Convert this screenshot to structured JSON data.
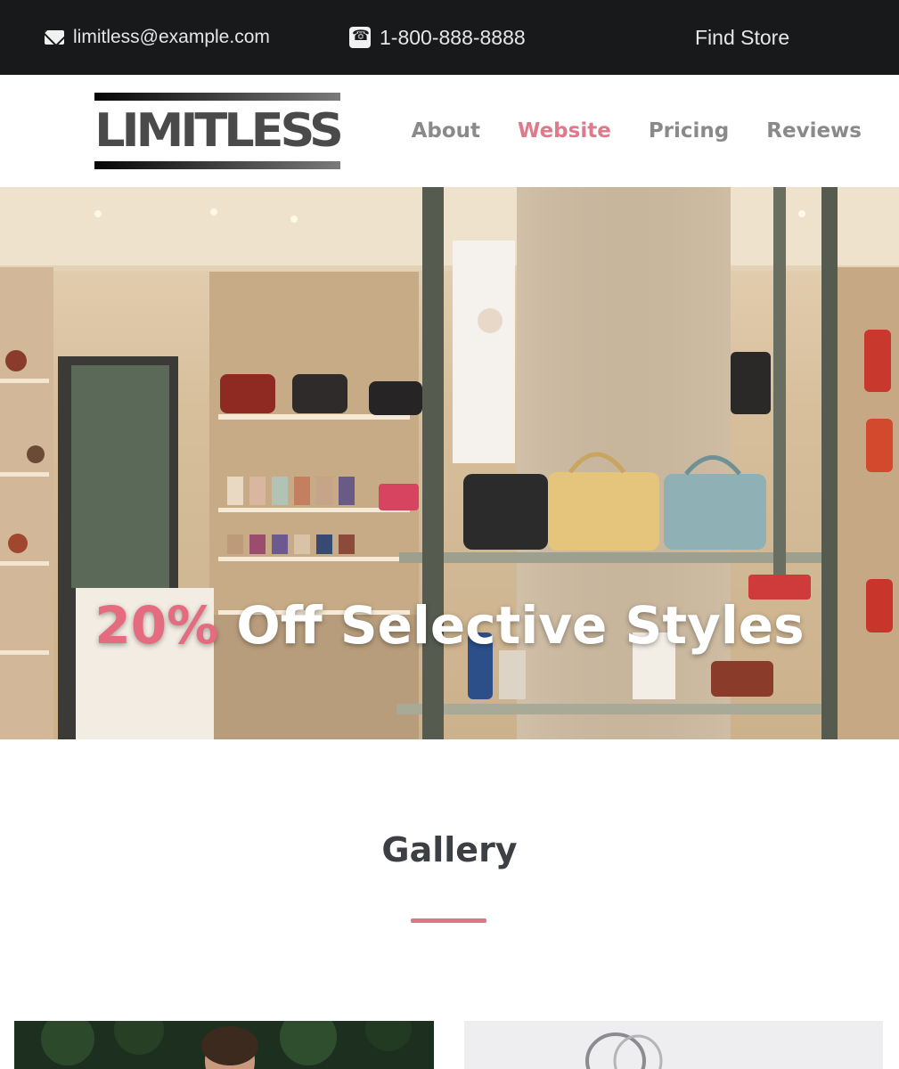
{
  "topbar": {
    "email": "limitless@example.com",
    "phone": "1-800-888-8888",
    "find_store": "Find Store",
    "icons": [
      "mail-icon",
      "phone-icon"
    ]
  },
  "header": {
    "logo_text": "LIMITLESS",
    "nav": [
      {
        "label": "About",
        "active": false
      },
      {
        "label": "Website",
        "active": true
      },
      {
        "label": "Pricing",
        "active": false
      },
      {
        "label": "Reviews",
        "active": false
      }
    ]
  },
  "hero": {
    "highlight": "20%",
    "headline": " Off Selective Styles"
  },
  "gallery": {
    "title": "Gallery"
  },
  "colors": {
    "accent": "#e07a8a",
    "topbar_bg": "#17191b",
    "heading": "#3c3f43"
  }
}
